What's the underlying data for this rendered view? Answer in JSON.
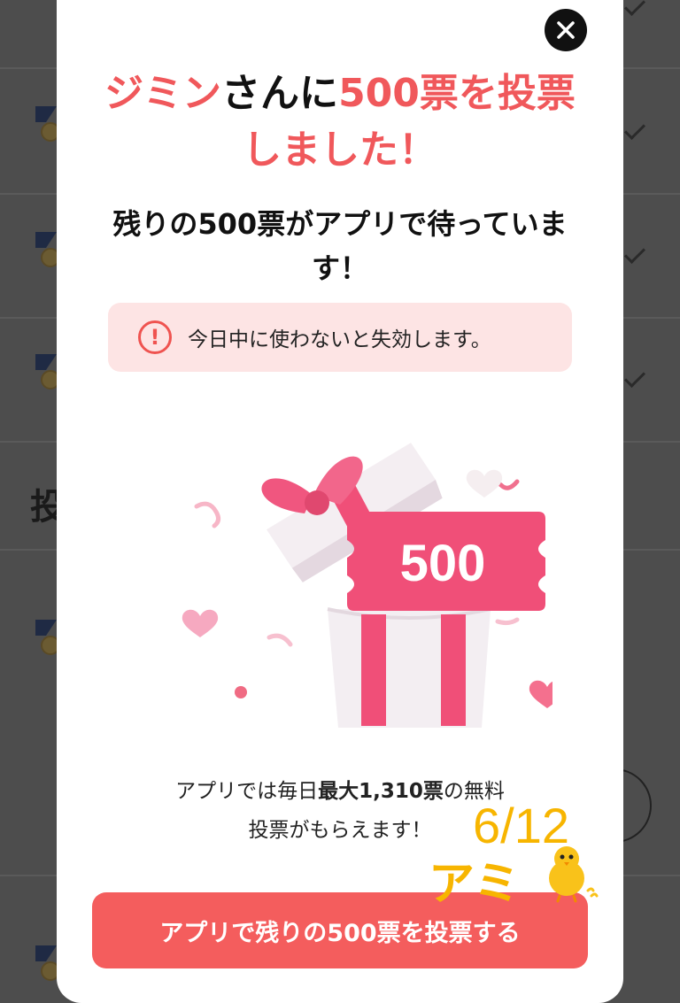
{
  "modal": {
    "title_name": "ジミン",
    "title_mid": "さんに",
    "title_votes": "500票を投票",
    "title_done": "しました！",
    "subtitle": "残りの500票がアプリで待っていま す！",
    "warning_text": "今日中に使わないと失効します。",
    "ticket_value": "500",
    "info_prefix": "アプリでは毎日",
    "info_bold": "最大1,310票",
    "info_suffix": "の無料",
    "info_line2": "投票がもらえます！",
    "cta_label": "アプリで残りの500票を投票する"
  },
  "background": {
    "heading_fragment": "投"
  },
  "sticker": {
    "date": "6/12",
    "name": "アミ"
  },
  "icons": [
    "close-icon",
    "warning-icon",
    "gift-illustration",
    "chick-sticker-icon",
    "checkmark-icon",
    "medal-icon"
  ],
  "colors": {
    "accent_red": "#f0585b",
    "cta_background": "#f45d5d",
    "warning_background": "#fde4e4",
    "ticket_pink": "#f04f78",
    "sticker_yellow": "#f7b500"
  }
}
